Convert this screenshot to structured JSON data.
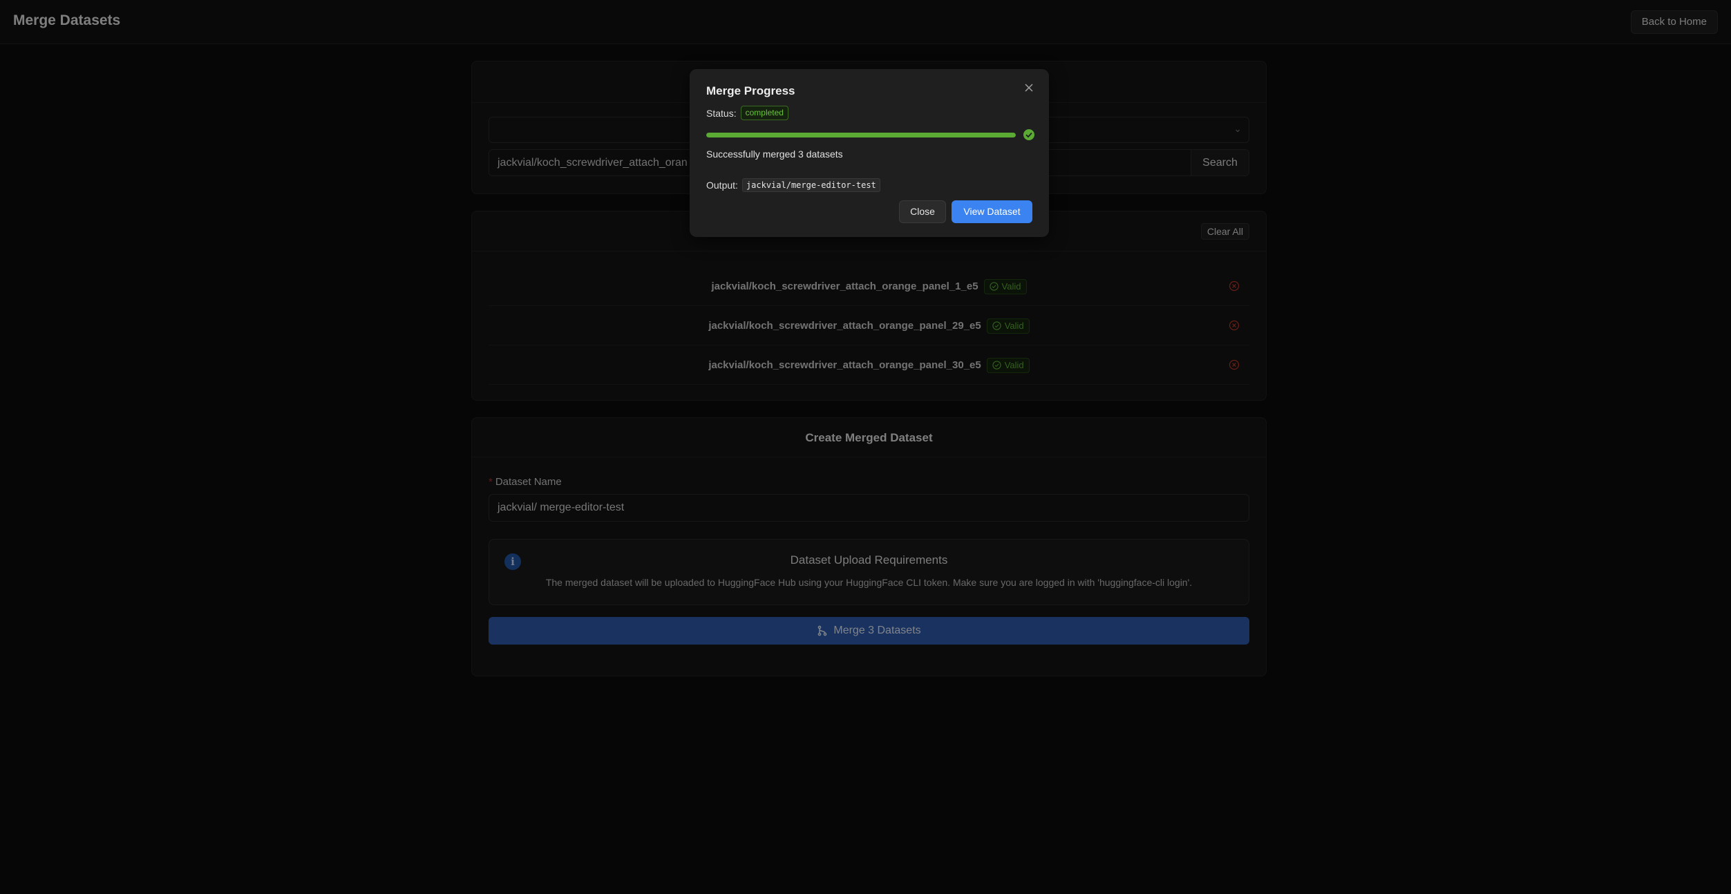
{
  "header": {
    "title": "Merge Datasets",
    "back_label": "Back to Home"
  },
  "search": {
    "query": "jackvial/koch_screwdriver_attach_oran",
    "button_label": "Search"
  },
  "selected": {
    "clear_label": "Clear All",
    "items": [
      {
        "name": "jackvial/koch_screwdriver_attach_orange_panel_1_e5",
        "status": "Valid"
      },
      {
        "name": "jackvial/koch_screwdriver_attach_orange_panel_29_e5",
        "status": "Valid"
      },
      {
        "name": "jackvial/koch_screwdriver_attach_orange_panel_30_e5",
        "status": "Valid"
      }
    ]
  },
  "create": {
    "title": "Create Merged Dataset",
    "required_mark": "*",
    "name_label": "Dataset Name",
    "name_value": "jackvial/ merge-editor-test",
    "info_title": "Dataset Upload Requirements",
    "info_desc": "The merged dataset will be uploaded to HuggingFace Hub using your HuggingFace CLI token. Make sure you are logged in with 'huggingface-cli login'.",
    "merge_label": "Merge 3 Datasets"
  },
  "modal": {
    "title": "Merge Progress",
    "status_label": "Status:",
    "status_value": "completed",
    "progress": 1.0,
    "message": "Successfully merged 3 datasets",
    "output_label": "Output:",
    "output_value": "jackvial/merge-editor-test",
    "close_label": "Close",
    "view_label": "View Dataset"
  },
  "colors": {
    "accent": "#3a83f0",
    "success": "#5aaa34",
    "danger": "#c0392b"
  },
  "icons": {
    "select_chevron": "chevron-down-icon",
    "valid": "check-circle-icon",
    "remove": "close-circle-icon",
    "info": "info-icon",
    "merge": "branch-merge-icon",
    "modal_close": "close-icon",
    "progress_done": "check-circle-filled-icon"
  }
}
